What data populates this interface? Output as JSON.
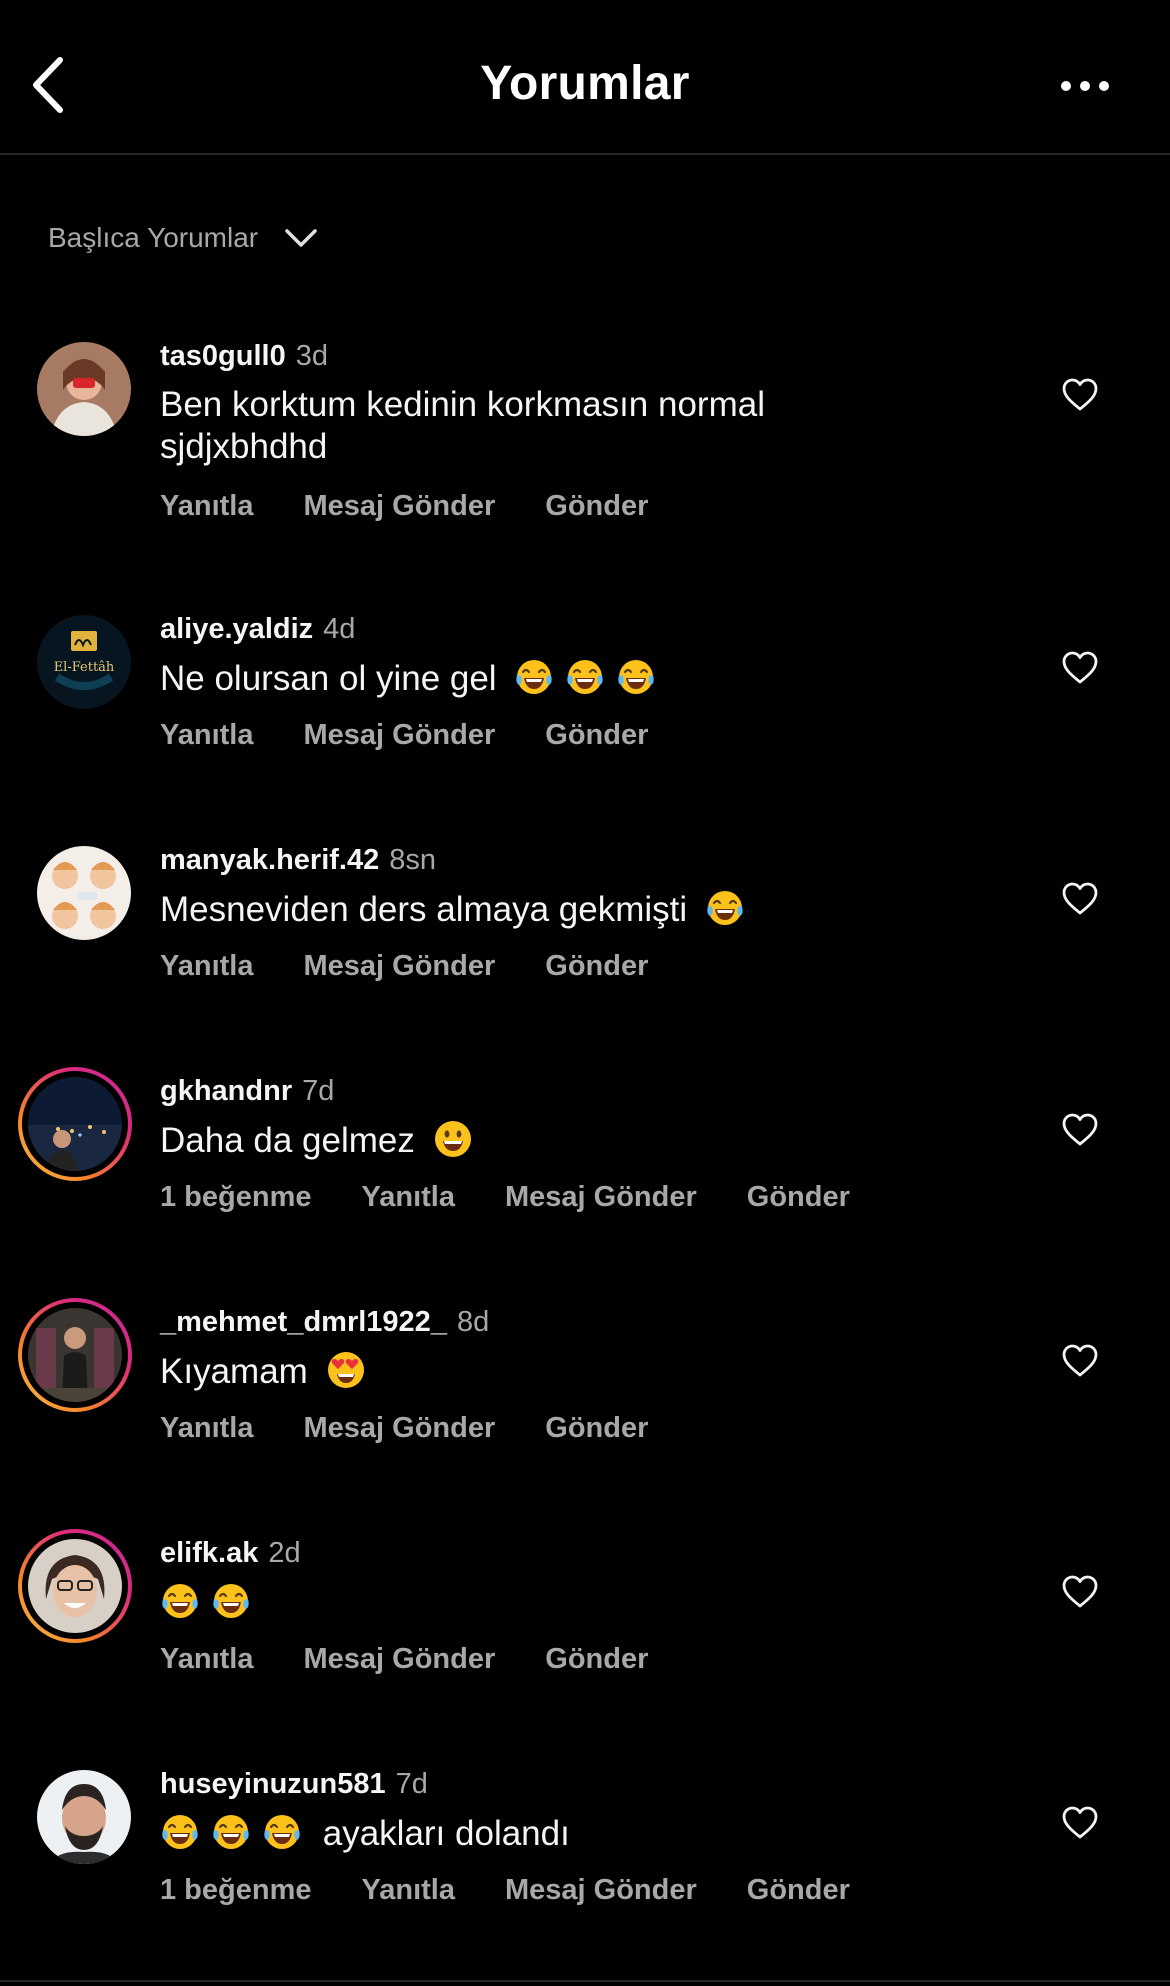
{
  "header": {
    "title": "Yorumlar"
  },
  "sort": {
    "label": "Başlıca Yorumlar"
  },
  "comments": [
    {
      "username": "tas0gull0",
      "time": "3d",
      "text": "Ben korktum kedinin korkmasın normal sjdjxbhdhd",
      "likes": "",
      "reply": "Yanıtla",
      "message": "Mesaj Gönder",
      "send": "Gönder"
    },
    {
      "username": "aliye.yaldiz",
      "time": "4d",
      "text": "Ne olursan ol yine gel",
      "likes": "",
      "reply": "Yanıtla",
      "message": "Mesaj Gönder",
      "send": "Gönder",
      "avatar_text": "El-Fettâh"
    },
    {
      "username": "manyak.herif.42",
      "time": "8sn",
      "text": "Mesneviden ders almaya gekmişti",
      "likes": "",
      "reply": "Yanıtla",
      "message": "Mesaj Gönder",
      "send": "Gönder"
    },
    {
      "username": "gkhandnr",
      "time": "7d",
      "text": "Daha da gelmez",
      "likes": "1 beğenme",
      "reply": "Yanıtla",
      "message": "Mesaj Gönder",
      "send": "Gönder"
    },
    {
      "username": "_mehmet_dmrl1922_",
      "time": "8d",
      "text": "Kıyamam",
      "likes": "",
      "reply": "Yanıtla",
      "message": "Mesaj Gönder",
      "send": "Gönder"
    },
    {
      "username": "elifk.ak",
      "time": "2d",
      "text": "",
      "likes": "",
      "reply": "Yanıtla",
      "message": "Mesaj Gönder",
      "send": "Gönder"
    },
    {
      "username": "huseyinuzun581",
      "time": "7d",
      "text": "ayakları dolandı",
      "likes": "1 beğenme",
      "reply": "Yanıtla",
      "message": "Mesaj Gönder",
      "send": "Gönder"
    }
  ],
  "icons": {
    "back": "chevron-left-icon",
    "more": "ellipsis-icon",
    "sort": "chevron-down-icon",
    "like": "heart-outline-icon",
    "emoji_laugh": "tears-of-joy-emoji",
    "emoji_grin": "grinning-emoji",
    "emoji_heart_eyes": "heart-eyes-emoji"
  },
  "colors": {
    "background": "#000000",
    "text": "#f5f5f5",
    "secondary": "#a8a8a8",
    "divider": "#262626",
    "story_ring": "#dd2a7b"
  }
}
